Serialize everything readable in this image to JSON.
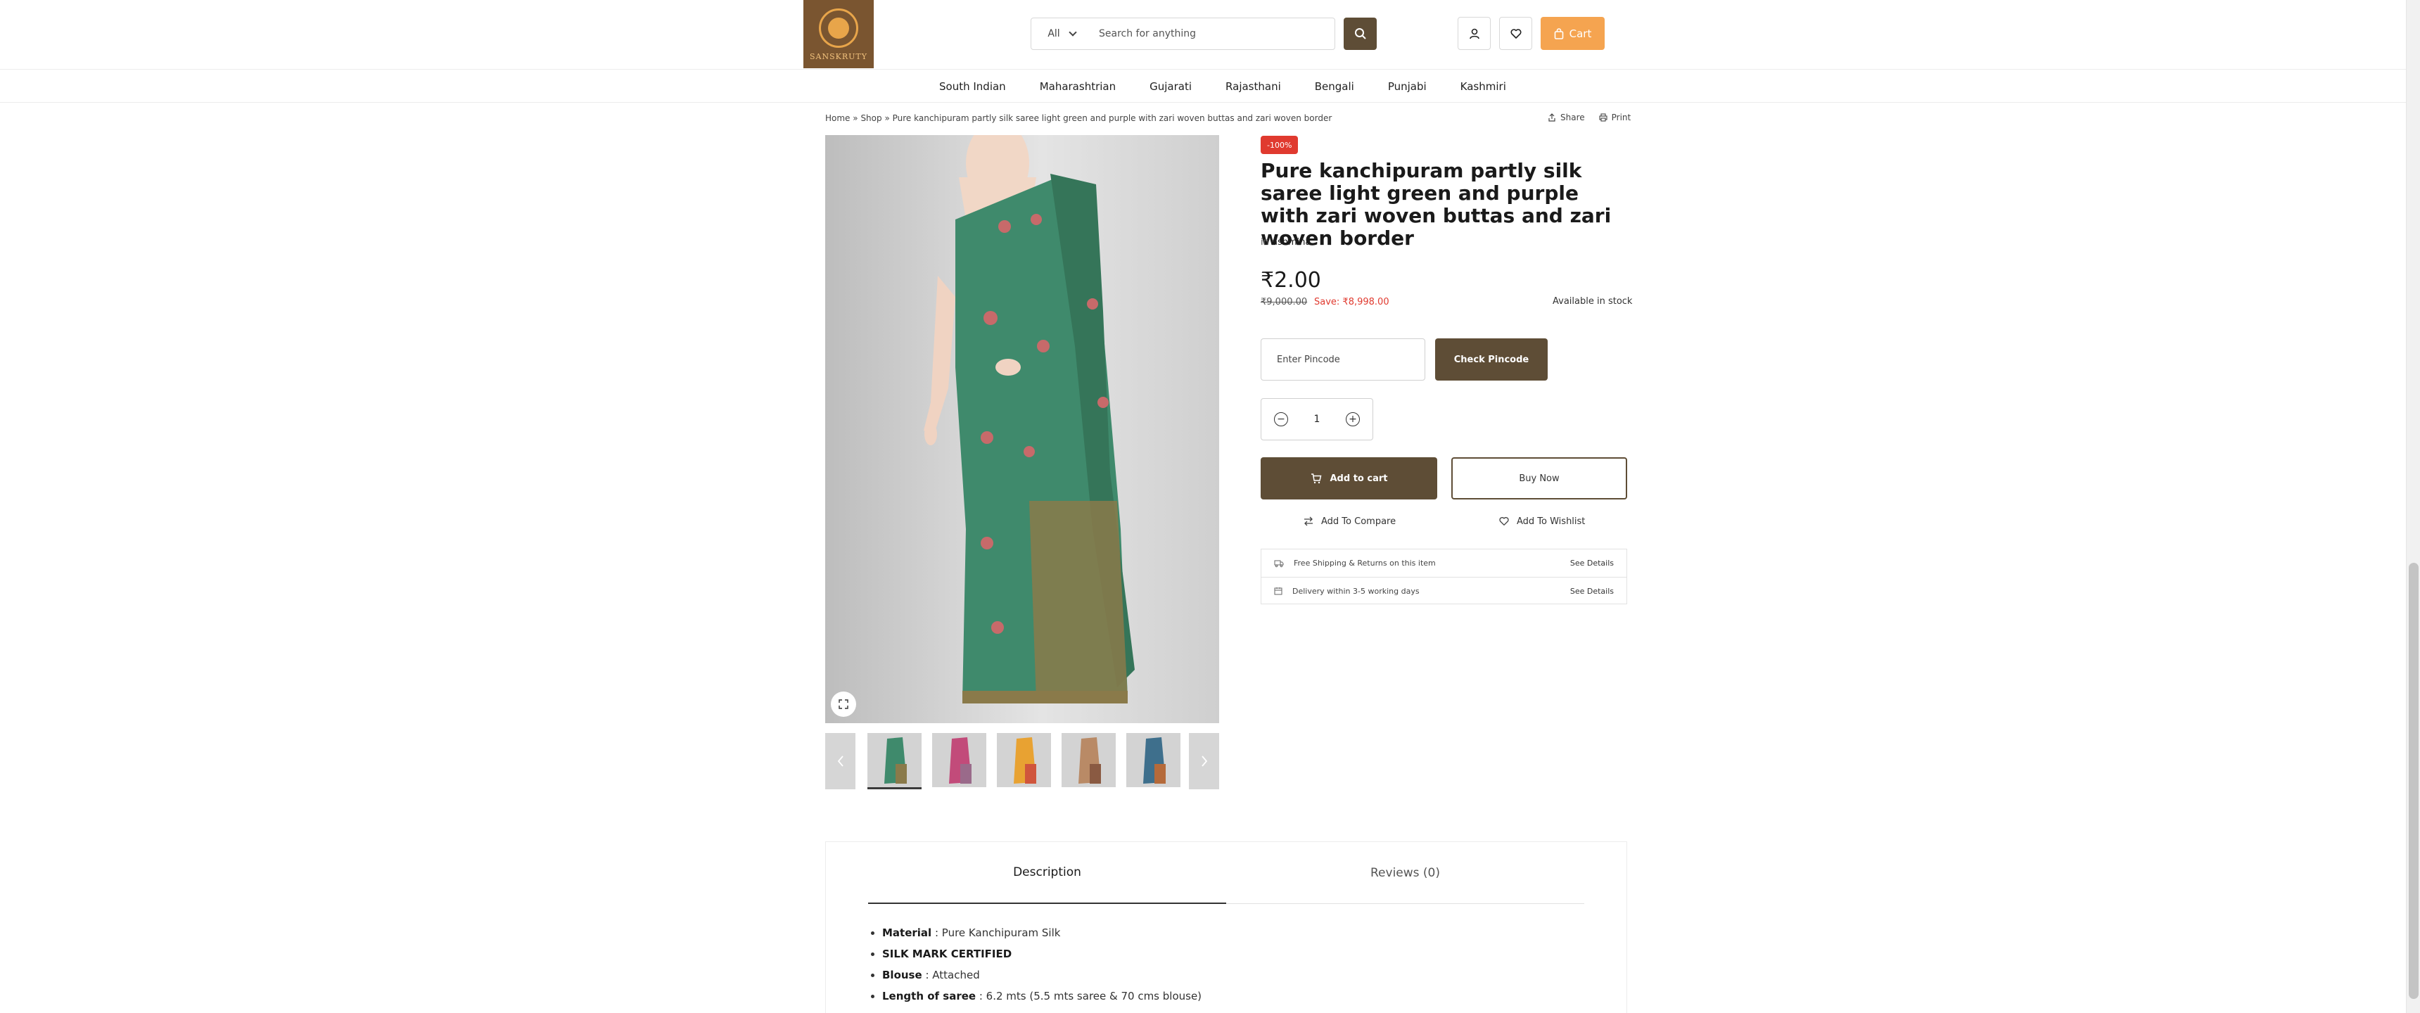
{
  "header": {
    "logo_text": "SANSKRUTY",
    "search": {
      "category": "All",
      "placeholder": "Search for anything",
      "value": ""
    },
    "cart_label": "Cart",
    "icons": [
      "user-icon",
      "heart-icon",
      "bag-icon",
      "search-icon"
    ]
  },
  "nav": {
    "items": [
      "South Indian",
      "Maharashtrian",
      "Gujarati",
      "Rajasthani",
      "Bengali",
      "Punjabi",
      "Kashmiri"
    ]
  },
  "breadcrumb": {
    "home": "Home",
    "shop": "Shop",
    "current": "Pure kanchipuram partly silk saree light green and purple with zari woven buttas and zari woven border",
    "separator": "»"
  },
  "page_actions": {
    "share": "Share",
    "print": "Print"
  },
  "gallery": {
    "colors": {
      "main_saree": "#3f8a6c",
      "border": "#8a7a4a",
      "thumbs": [
        "#3f8a6c",
        "#c24b7a",
        "#e8a232",
        "#b98a66",
        "#3e6f8c"
      ]
    }
  },
  "product": {
    "badge": "-100%",
    "title": "Pure kanchipuram partly silk saree light green and purple with zari woven buttas and zari woven border",
    "category_prefix": "in",
    "category": "ashmina",
    "price": "₹2.00",
    "old_price": "₹9,000.00",
    "save": "Save: ₹8,998.00",
    "stock": "Available in stock",
    "pincode_placeholder": "Enter Pincode",
    "check_pincode": "Check Pincode",
    "quantity": "1",
    "add_to_cart": "Add to cart",
    "buy_now": "Buy Now",
    "add_to_compare": "Add To Compare",
    "add_to_wishlist": "Add To Wishlist",
    "info": [
      {
        "label": "Free Shipping & Returns on this item",
        "link": "See Details",
        "icon": "truck-icon"
      },
      {
        "label": "Delivery within 3-5 working days",
        "link": "See Details",
        "icon": "calendar-icon"
      }
    ]
  },
  "description": {
    "tabs": [
      "Description",
      "Reviews (0)"
    ],
    "items": [
      {
        "key": "Material",
        "value": ": Pure Kanchipuram Silk"
      },
      {
        "key": "SILK MARK CERTIFIED",
        "value": ""
      },
      {
        "key": "Blouse",
        "value": ": Attached"
      },
      {
        "key": "Length of saree",
        "value": ": 6.2 mts (5.5 mts saree & 70 cms blouse)"
      }
    ]
  },
  "colors": {
    "brand": "#5e4d36",
    "cart": "#f5a450",
    "sale": "#e03a2f"
  }
}
